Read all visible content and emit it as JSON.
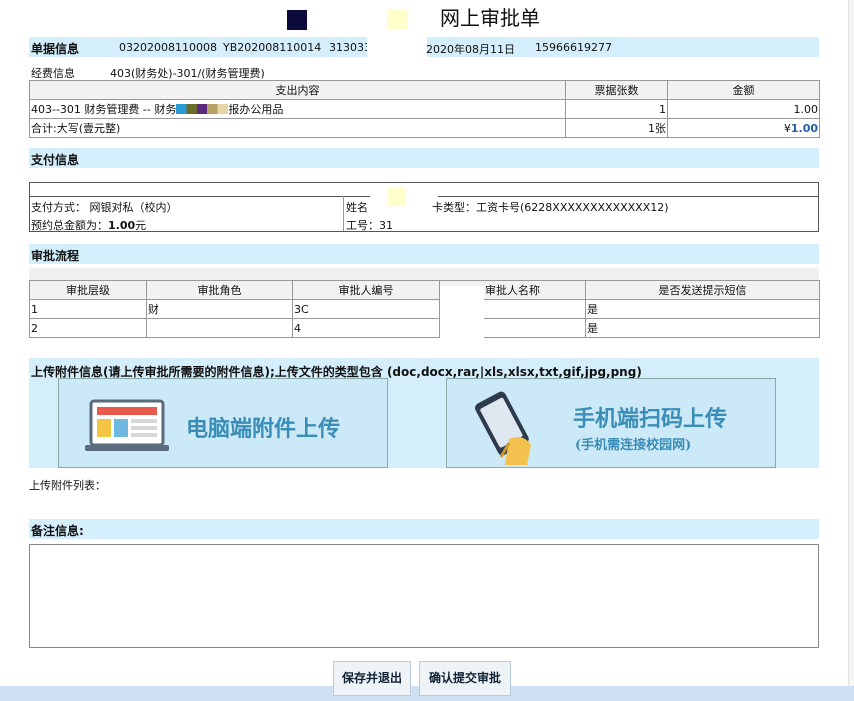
{
  "page_title": "网上审批单",
  "document_info": {
    "section_title": "单据信息",
    "doc_no": "03202008110008",
    "yb_no": "YB202008110014",
    "id_partial": "313033",
    "date": "2020年08月11日",
    "phone": "15966619277"
  },
  "fund_info": {
    "label": "经费信息",
    "value": "403(财务处)-301/(财务管理费)"
  },
  "expense_table": {
    "headers": [
      "支出内容",
      "票据张数",
      "金额"
    ],
    "row": {
      "content": "403--301 财务管理费 -- 财务",
      "content_tail": "报办公用品",
      "count": "1",
      "amount": "1.00"
    },
    "total": {
      "label": "合计:大写(壹元整)",
      "count": "1张",
      "amount_prefix": "¥",
      "amount": "1.00"
    }
  },
  "payment": {
    "section_title": "支付信息",
    "method": "支付方式：  网银对私（校内）",
    "total_label": "预约总金额为：",
    "total_value": "1.00",
    "total_unit": "元",
    "name_label": "姓名",
    "card_info": "卡类型：工资卡号(6228XXXXXXXXXXXXX12)",
    "id_label": "工号：",
    "id_partial": "31"
  },
  "approval": {
    "section_title": "审批流程",
    "headers": [
      "审批层级",
      "审批角色",
      "审批人编号",
      "审批人名称",
      "是否发送提示短信"
    ],
    "rows": [
      {
        "level": "1",
        "role": "财",
        "id": "3C",
        "name": "",
        "sms": "是"
      },
      {
        "level": "2",
        "role": "",
        "id": "4",
        "name": "",
        "sms": "是"
      }
    ]
  },
  "attachments": {
    "section_title": "上传附件信息(请上传审批所需要的附件信息);上传文件的类型包含 (doc,docx,rar,|xls,xlsx,txt,gif,jpg,png)",
    "pc_upload": "电脑端附件上传",
    "mobile_upload": "手机端扫码上传",
    "mobile_note": "(手机需连接校园网)",
    "list_label": "上传附件列表："
  },
  "remarks": {
    "section_title": "备注信息:",
    "value": ""
  },
  "actions": {
    "save_exit": "保存并退出",
    "confirm_submit": "确认提交审批"
  },
  "colors": {
    "section_bar": "#d4eefb",
    "accent_blue": "#3a8db7",
    "amount_blue": "#1f5fa8"
  }
}
